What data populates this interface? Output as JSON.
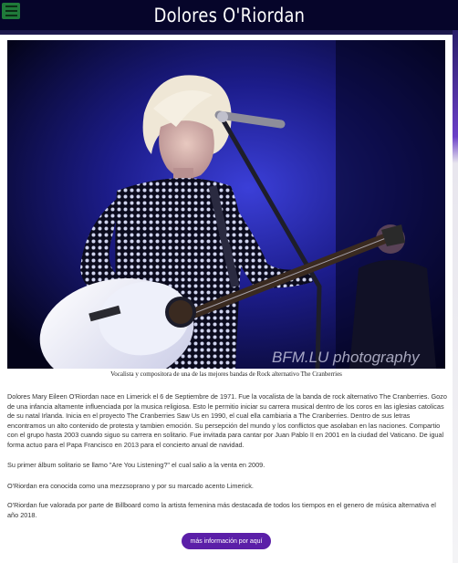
{
  "header": {
    "title": "Dolores O'Riordan",
    "menu_icon": "hamburger-menu-icon"
  },
  "hero": {
    "watermark": "BFM.LU photography",
    "caption": "Vocalista y compositora de una de las mejores bandas de Rock alternativo The Cranberries"
  },
  "article": {
    "paragraphs": [
      "Dolores Mary Eileen O'Riordan nace en Limerick el 6 de Septiembre de 1971. Fue la vocalista de la banda de rock alternativo The Cranberries. Gozo de una infancia altamente influenciada por la musica religiosa. Esto le permitio iniciar su carrera musical dentro de los coros en las iglesias catolicas de su natal Irlanda. Inicia en el proyecto The Cranberries Saw Us en 1990, el cual ella cambiaria a The Cranberries. Dentro de sus letras encontramos un alto contenido de protesta y tambien emoción. Su persepción del mundo y los conflictos que asolaban en las naciones. Compartio con el grupo hasta 2003 cuando siguo su carrera en solitario. Fue invitada para cantar por Juan Pablo II en 2001 en la ciudad del Vaticano. De igual forma actuo para el Papa Francisco en 2013 para el concierto anual de navidad.",
      "Su primer álbum solitario se llamo \"Are You Listening?\" el cual salio a la venta en 2009.",
      "O'Riordan era conocida como una mezzsoprano y por su marcado acento Limerick.",
      "O'Riordan fue valorada por parte de Billboard como la artista femenina más destacada de todos los tiempos en el genero de música alternativa el año 2018."
    ]
  },
  "more_button": {
    "label": "más información por aquí"
  }
}
